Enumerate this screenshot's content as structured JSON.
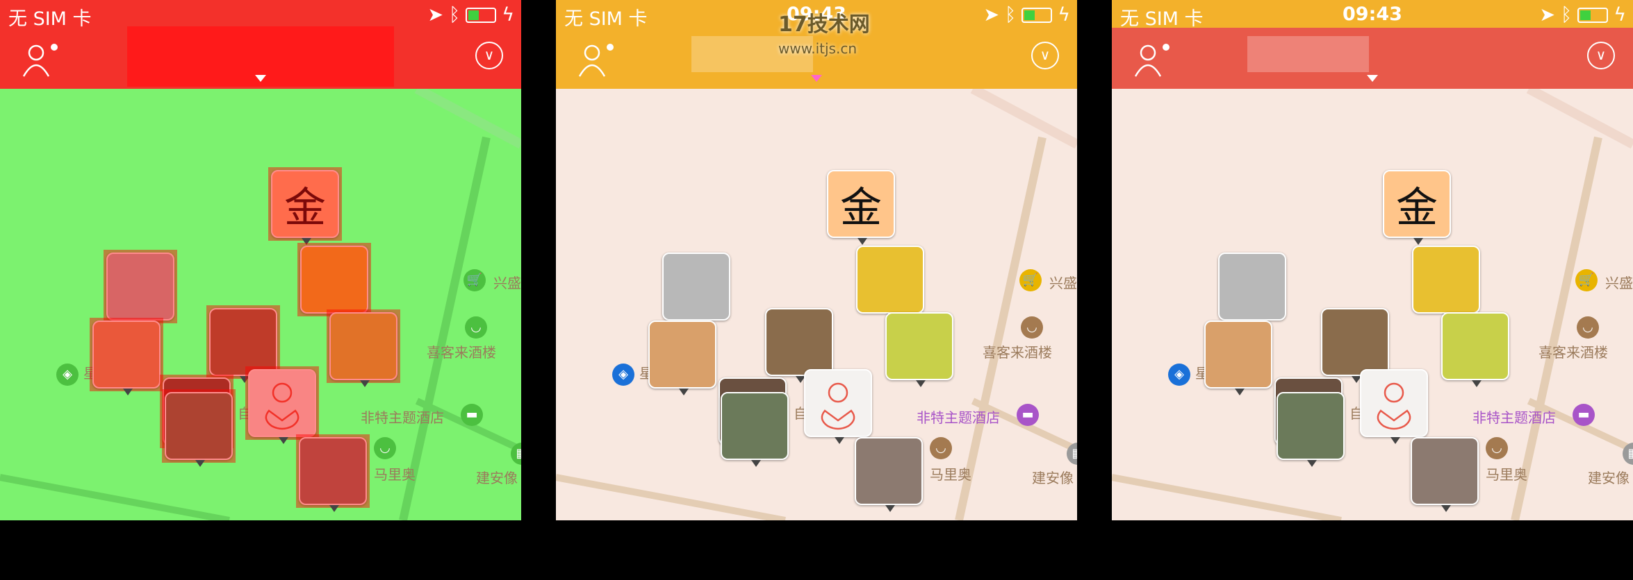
{
  "status_bar": {
    "carrier": "无 SIM 卡",
    "time": "09:43"
  },
  "watermark": {
    "logo": "17技术网",
    "url": "www.itjs.cn"
  },
  "panels": [
    {
      "variant": "debug-overlay",
      "status_color": "#f3312b",
      "header_color": "#f3312b",
      "map_color": "#7cf26f",
      "title_overlay": "#ff1a1a",
      "arrow_color": "#ffffff",
      "show_time": false
    },
    {
      "variant": "orange",
      "status_color": "#f3b12b",
      "header_color": "#f3b12b",
      "map_color": "#f8e8e0",
      "title_overlay": "rgba(255,255,255,0.25)",
      "arrow_color": "#ff66cc",
      "show_time": true
    },
    {
      "variant": "red",
      "status_color": "#f3b12b",
      "header_color": "#e8594a",
      "map_color": "#f8e8e0",
      "title_overlay": "rgba(255,255,255,0.25)",
      "arrow_color": "#ffffff",
      "show_time": true
    }
  ],
  "markers": [
    {
      "type": "calligraphy",
      "glyph": "金",
      "color": "#ffc58a"
    },
    {
      "type": "photo",
      "color": "#b8b8b8"
    },
    {
      "type": "photo",
      "color": "#d9a06a"
    },
    {
      "type": "photo",
      "color": "#8a6c4c"
    },
    {
      "type": "photo",
      "color": "#e8c030"
    },
    {
      "type": "photo",
      "color": "#c8d04a"
    },
    {
      "type": "photo",
      "color": "#6a5040"
    },
    {
      "type": "photo",
      "color": "#6b7a5a"
    },
    {
      "type": "default-avatar",
      "color": "#f4f2f0"
    },
    {
      "type": "photo",
      "color": "#8c7a70"
    }
  ],
  "pois": [
    {
      "label": "兴盛",
      "icon": "cart-icon",
      "color": "#e8b400"
    },
    {
      "label": "喜客来酒楼",
      "icon": "bowl-icon",
      "color": "#a47a50"
    },
    {
      "label": "非特主题酒店",
      "icon": "bed-icon",
      "color": "#a854c8",
      "label_color": "#a854c8"
    },
    {
      "label": "马里奥",
      "icon": "bowl-icon",
      "color": "#a47a50"
    },
    {
      "label": "建安像",
      "icon": "building-icon",
      "color": "#9a9a9a"
    },
    {
      "label": "星",
      "icon": "bank-icon",
      "color": "#1a70d8"
    },
    {
      "label": "自",
      "icon": "bowl-icon",
      "color": "#a47a50"
    }
  ]
}
